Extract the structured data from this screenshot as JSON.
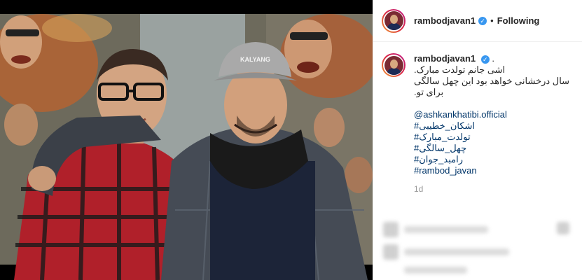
{
  "header": {
    "username": "rambodjavan1",
    "verified_icon": "✓",
    "separator": "•",
    "follow_label": "Following"
  },
  "post": {
    "username": "rambodjavan1",
    "verified_icon": "✓",
    "trailing": ".",
    "lines": [
      "اشی جانم تولدت مبارک.",
      "سال درخشانی خواهد بود این چهل سالگی برای تو."
    ],
    "mention": "@ashkankhatibi.official",
    "hashtags": [
      "#اشکان_خطیبی",
      "#تولدت_مبارک",
      "#چهل_سالگی",
      "#رامبد_جوان",
      "#rambod_javan"
    ],
    "time": "1d"
  },
  "photo": {
    "cap_text": "KALYANG"
  },
  "colors": {
    "link": "#003569",
    "verified": "#3897f0",
    "text": "#262626",
    "muted": "#999999"
  }
}
